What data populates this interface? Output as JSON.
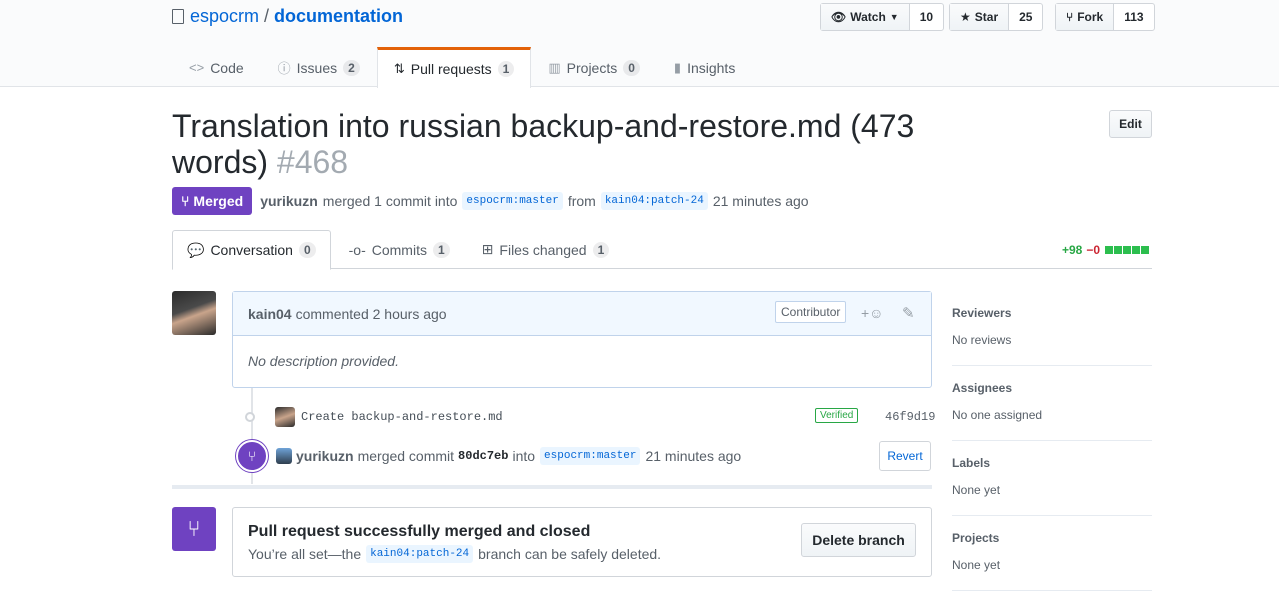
{
  "repo": {
    "owner": "espocrm",
    "separator": "/",
    "name": "documentation"
  },
  "actions": {
    "watch_label": "Watch",
    "watch_count": "10",
    "star_label": "Star",
    "star_count": "25",
    "fork_label": "Fork",
    "fork_count": "113"
  },
  "tabs": [
    {
      "label": "Code",
      "count": ""
    },
    {
      "label": "Issues",
      "count": "2"
    },
    {
      "label": "Pull requests",
      "count": "1"
    },
    {
      "label": "Projects",
      "count": "0"
    },
    {
      "label": "Insights",
      "count": ""
    }
  ],
  "pr": {
    "title": "Translation into russian backup-and-restore.md (473 words)",
    "number": "#468",
    "edit_label": "Edit",
    "state": "Merged",
    "merger": "yurikuzn",
    "meta_text": "merged 1 commit into",
    "base_branch": "espocrm:master",
    "from_text": "from",
    "head_branch": "kain04:patch-24",
    "time": "21 minutes ago"
  },
  "pr_tabs": [
    {
      "label": "Conversation",
      "count": "0"
    },
    {
      "label": "Commits",
      "count": "1"
    },
    {
      "label": "Files changed",
      "count": "1"
    }
  ],
  "diffstat": {
    "additions": "+98",
    "deletions": "−0"
  },
  "comment": {
    "author": "kain04",
    "action": "commented 2 hours ago",
    "badge": "Contributor",
    "body": "No description provided."
  },
  "commit": {
    "message": "Create backup-and-restore.md",
    "verified": "Verified",
    "sha": "46f9d19"
  },
  "merge_event": {
    "user": "yurikuzn",
    "text": "merged commit",
    "sha": "80dc7eb",
    "into": "into",
    "branch": "espocrm:master",
    "time": "21 minutes ago",
    "revert_label": "Revert"
  },
  "merge_box": {
    "heading": "Pull request successfully merged and closed",
    "text_before": "You’re all set—the",
    "branch": "kain04:patch-24",
    "text_after": "branch can be safely deleted.",
    "delete_label": "Delete branch"
  },
  "sidebar": [
    {
      "heading": "Reviewers",
      "value": "No reviews"
    },
    {
      "heading": "Assignees",
      "value": "No one assigned"
    },
    {
      "heading": "Labels",
      "value": "None yet"
    },
    {
      "heading": "Projects",
      "value": "None yet"
    }
  ]
}
